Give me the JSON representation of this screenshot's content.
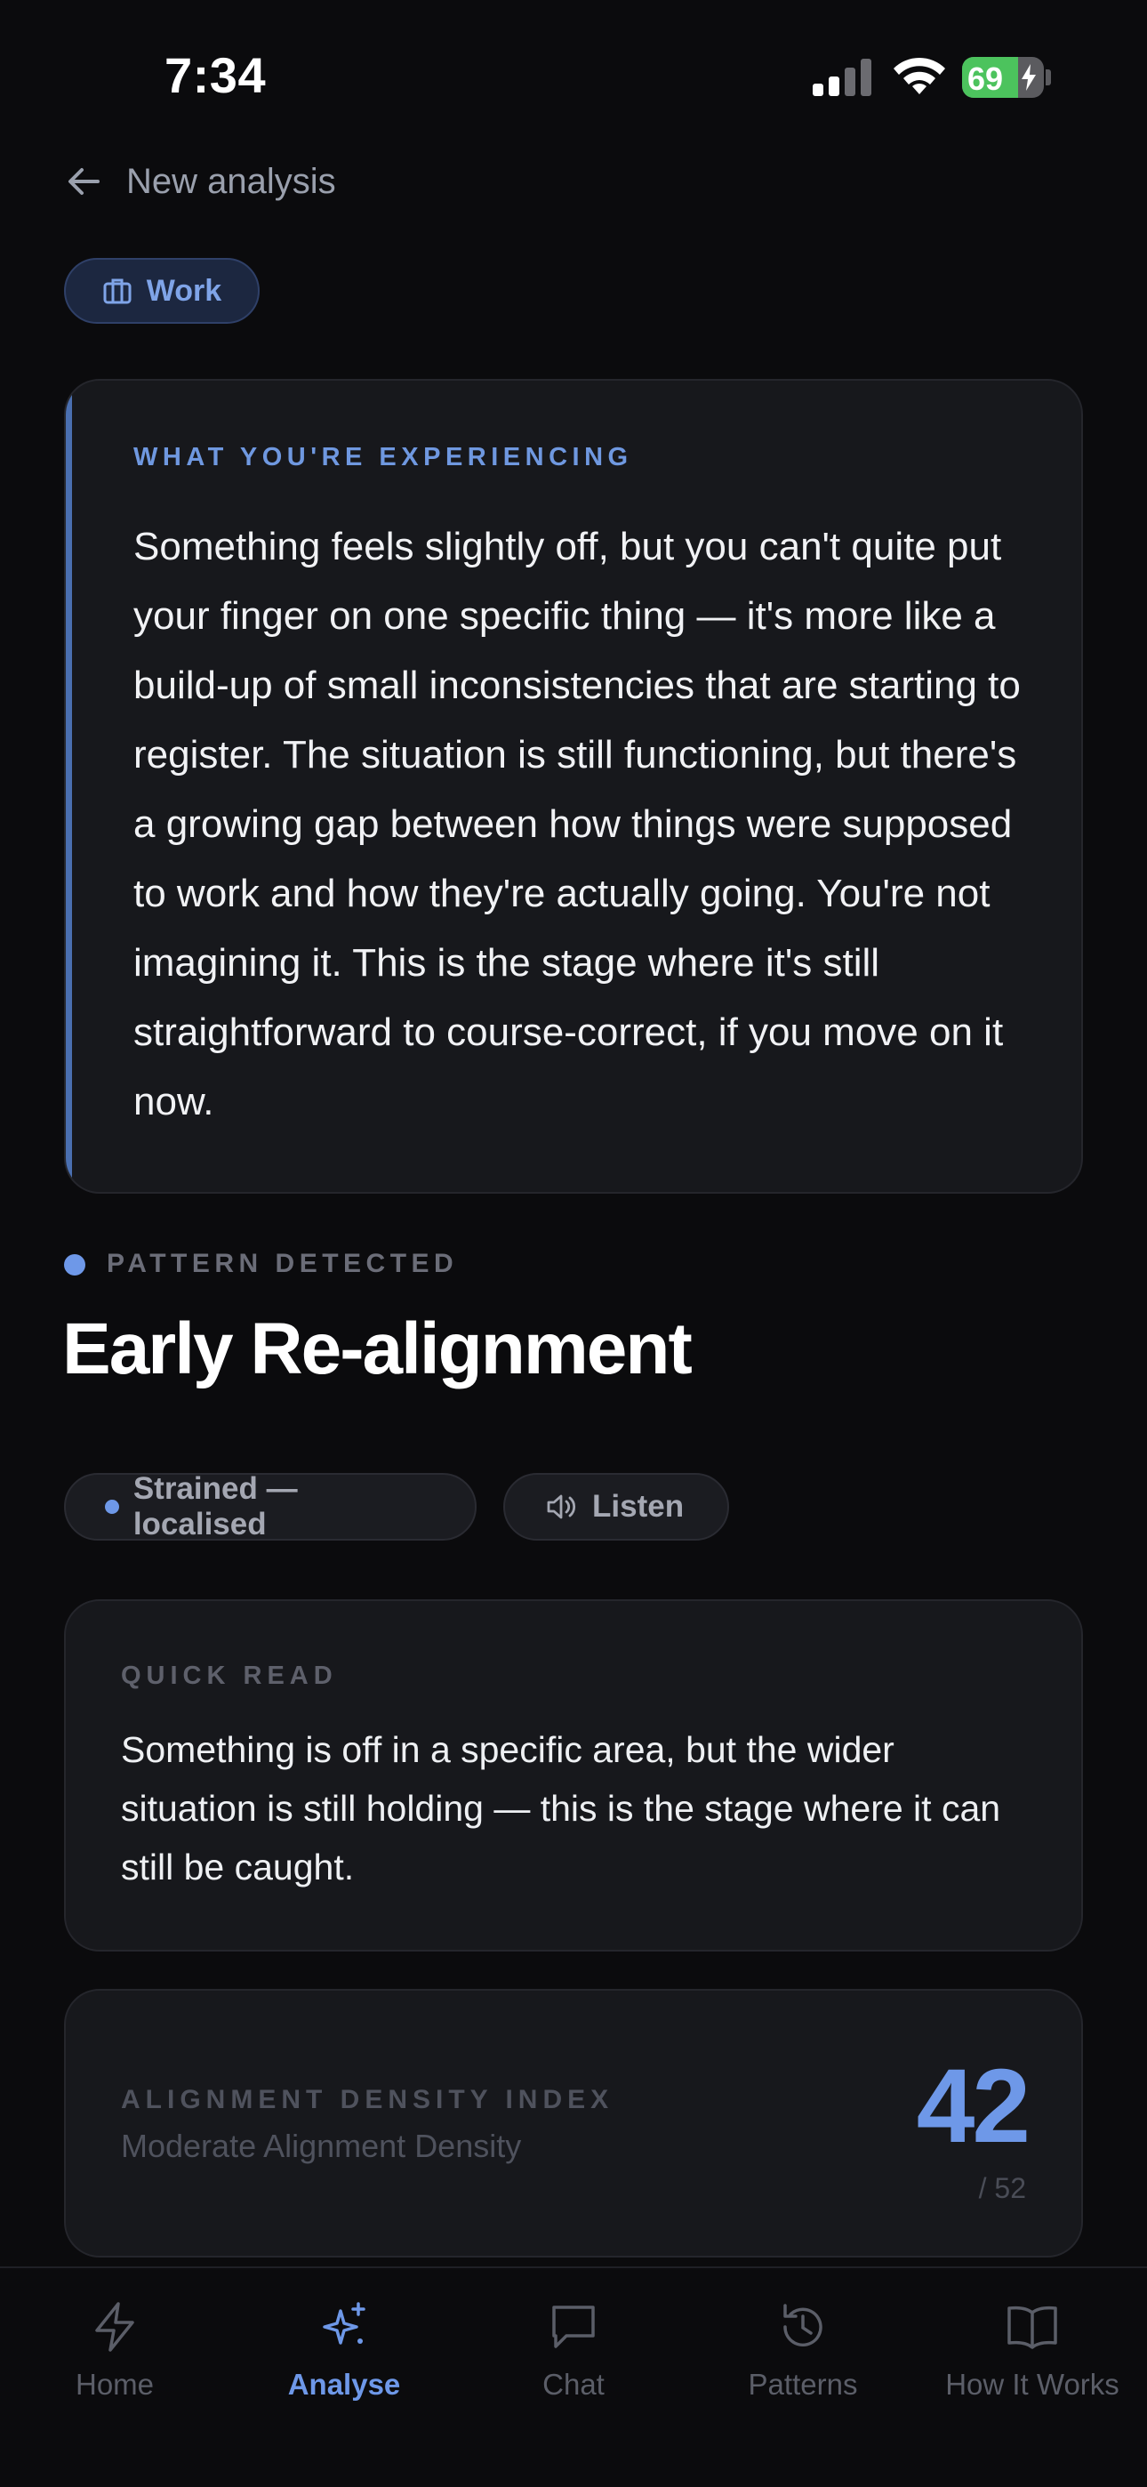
{
  "status_bar": {
    "time": "7:34",
    "battery_level": "69",
    "battery_fraction": 0.69
  },
  "nav": {
    "back_label": "New analysis"
  },
  "category": {
    "label": "Work",
    "icon": "briefcase-icon"
  },
  "experience": {
    "label": "WHAT YOU'RE EXPERIENCING",
    "text": "Something feels slightly off, but you can't quite put your finger on one specific thing — it's more like a build-up of small inconsistencies that are starting to register. The situation is still functioning, but there's a growing gap between how things were supposed to work and how they're actually going. You're not imagining it. This is the stage where it's still straightforward to course-correct, if you move on it now."
  },
  "pattern": {
    "label": "PATTERN DETECTED",
    "title": "Early Re-alignment",
    "status": "Strained — localised",
    "listen_label": "Listen"
  },
  "quick_read": {
    "label": "QUICK READ",
    "text": "Something is off in a specific area, but the wider situation is still holding — this is the stage where it can still be caught."
  },
  "adi": {
    "label": "ALIGNMENT DENSITY INDEX",
    "sublabel": "Moderate Alignment Density",
    "value": "42",
    "max": "/ 52"
  },
  "tabs": [
    {
      "label": "Home",
      "icon": "bolt-icon",
      "active": false
    },
    {
      "label": "Analyse",
      "icon": "sparkles-icon",
      "active": true
    },
    {
      "label": "Chat",
      "icon": "chat-bubble-icon",
      "active": false
    },
    {
      "label": "Patterns",
      "icon": "history-icon",
      "active": false
    },
    {
      "label": "How It Works",
      "icon": "book-icon",
      "active": false
    }
  ],
  "colors": {
    "background": "#0b0b0d",
    "card": "#17181c",
    "accent_blue": "#6e98e8",
    "battery_green": "#4cc35d"
  }
}
